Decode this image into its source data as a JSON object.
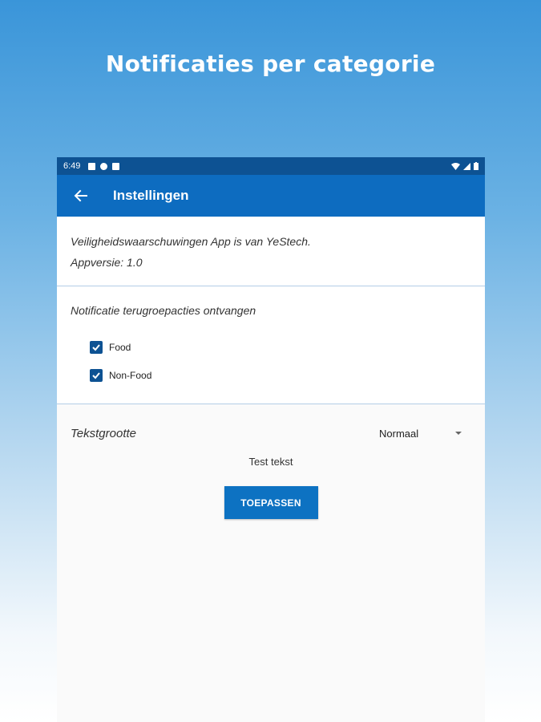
{
  "headline": "Notificaties per categorie",
  "statusbar": {
    "time": "6:49"
  },
  "appbar": {
    "title": "Instellingen"
  },
  "info": {
    "line1": "Veiligheidswaarschuwingen App is van YeStech.",
    "line2": "Appversie: 1.0"
  },
  "notifications": {
    "heading": "Notificatie terugroepacties ontvangen",
    "options": [
      {
        "label": "Food",
        "checked": true
      },
      {
        "label": "Non-Food",
        "checked": true
      }
    ]
  },
  "text_size": {
    "label": "Tekstgrootte",
    "selected": "Normaal",
    "sample": "Test tekst",
    "apply_label": "TOEPASSEN"
  },
  "colors": {
    "appbar": "#0d6cc0",
    "statusbar": "#0d5293",
    "checkbox": "#0d5293",
    "button": "#0d72c2"
  },
  "icons": [
    "back-arrow-icon",
    "wifi-icon",
    "signal-icon",
    "battery-icon",
    "check-icon",
    "dropdown-caret-icon"
  ]
}
